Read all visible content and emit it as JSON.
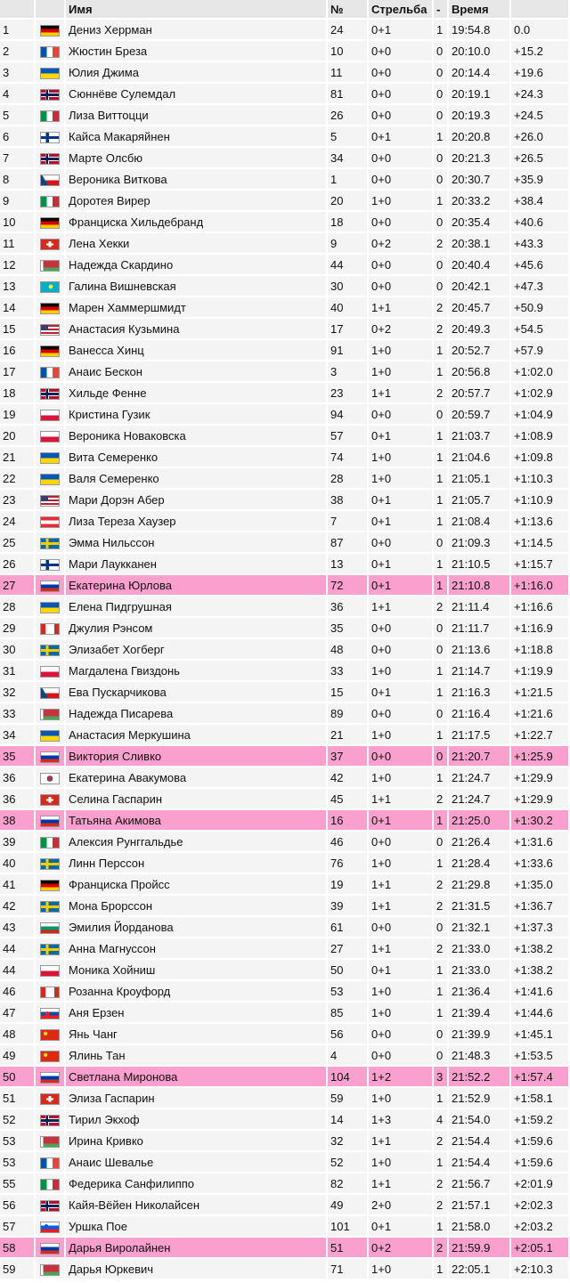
{
  "headers": {
    "pos": "",
    "flag": "",
    "name": "Имя",
    "no": "№",
    "shooting": "Стрельба",
    "penalty": "-",
    "time": "Время",
    "gap": ""
  },
  "colors": {
    "highlight": "#f9a0cf",
    "header": "#e7e7e7",
    "row": "#f4f4f4"
  },
  "rows": [
    {
      "pos": "1",
      "flag": "germany-flag",
      "name": "Дениз Херрман",
      "no": "24",
      "shooting": "0+1",
      "penalty": "1",
      "time": "19:54.8",
      "gap": "0.0",
      "hl": false
    },
    {
      "pos": "2",
      "flag": "france-flag",
      "name": "Жюстин Бреза",
      "no": "10",
      "shooting": "0+0",
      "penalty": "0",
      "time": "20:10.0",
      "gap": "+15.2",
      "hl": false
    },
    {
      "pos": "3",
      "flag": "ukraine-flag",
      "name": "Юлия Джима",
      "no": "11",
      "shooting": "0+0",
      "penalty": "0",
      "time": "20:14.4",
      "gap": "+19.6",
      "hl": false
    },
    {
      "pos": "4",
      "flag": "norway-flag",
      "name": "Сюннёве Сулемдал",
      "no": "81",
      "shooting": "0+0",
      "penalty": "0",
      "time": "20:19.1",
      "gap": "+24.3",
      "hl": false
    },
    {
      "pos": "5",
      "flag": "italy-flag",
      "name": "Лиза Виттоцци",
      "no": "26",
      "shooting": "0+0",
      "penalty": "0",
      "time": "20:19.3",
      "gap": "+24.5",
      "hl": false
    },
    {
      "pos": "6",
      "flag": "finland-flag",
      "name": "Кайса Макаряйнен",
      "no": "5",
      "shooting": "0+1",
      "penalty": "1",
      "time": "20:20.8",
      "gap": "+26.0",
      "hl": false
    },
    {
      "pos": "7",
      "flag": "norway-flag",
      "name": "Марте Олсбю",
      "no": "34",
      "shooting": "0+0",
      "penalty": "0",
      "time": "20:21.3",
      "gap": "+26.5",
      "hl": false
    },
    {
      "pos": "8",
      "flag": "czech-flag",
      "name": "Вероника Виткова",
      "no": "1",
      "shooting": "0+0",
      "penalty": "0",
      "time": "20:30.7",
      "gap": "+35.9",
      "hl": false
    },
    {
      "pos": "9",
      "flag": "italy-flag",
      "name": "Доротея Вирер",
      "no": "20",
      "shooting": "1+0",
      "penalty": "1",
      "time": "20:33.2",
      "gap": "+38.4",
      "hl": false
    },
    {
      "pos": "10",
      "flag": "germany-flag",
      "name": "Франциска Хильдебранд",
      "no": "18",
      "shooting": "0+0",
      "penalty": "0",
      "time": "20:35.4",
      "gap": "+40.6",
      "hl": false
    },
    {
      "pos": "11",
      "flag": "switzerland-flag",
      "name": "Лена Хекки",
      "no": "9",
      "shooting": "0+2",
      "penalty": "2",
      "time": "20:38.1",
      "gap": "+43.3",
      "hl": false
    },
    {
      "pos": "12",
      "flag": "belarus-flag",
      "name": "Надежда Скардино",
      "no": "44",
      "shooting": "0+0",
      "penalty": "0",
      "time": "20:40.4",
      "gap": "+45.6",
      "hl": false
    },
    {
      "pos": "13",
      "flag": "kazakhstan-flag",
      "name": "Галина Вишневская",
      "no": "30",
      "shooting": "0+0",
      "penalty": "0",
      "time": "20:42.1",
      "gap": "+47.3",
      "hl": false
    },
    {
      "pos": "14",
      "flag": "germany-flag",
      "name": "Марен Хаммершмидт",
      "no": "40",
      "shooting": "1+1",
      "penalty": "2",
      "time": "20:45.7",
      "gap": "+50.9",
      "hl": false
    },
    {
      "pos": "15",
      "flag": "usa-flag",
      "name": "Анастасия Кузьмина",
      "no": "17",
      "shooting": "0+2",
      "penalty": "2",
      "time": "20:49.3",
      "gap": "+54.5",
      "hl": false
    },
    {
      "pos": "16",
      "flag": "germany-flag",
      "name": "Ванесса Хинц",
      "no": "91",
      "shooting": "1+0",
      "penalty": "1",
      "time": "20:52.7",
      "gap": "+57.9",
      "hl": false
    },
    {
      "pos": "17",
      "flag": "france-flag",
      "name": "Анаис Бескон",
      "no": "3",
      "shooting": "1+0",
      "penalty": "1",
      "time": "20:56.8",
      "gap": "+1:02.0",
      "hl": false
    },
    {
      "pos": "18",
      "flag": "norway-flag",
      "name": "Хильде Фенне",
      "no": "23",
      "shooting": "1+1",
      "penalty": "2",
      "time": "20:57.7",
      "gap": "+1:02.9",
      "hl": false
    },
    {
      "pos": "19",
      "flag": "poland-flag",
      "name": "Кристина Гузик",
      "no": "94",
      "shooting": "0+0",
      "penalty": "0",
      "time": "20:59.7",
      "gap": "+1:04.9",
      "hl": false
    },
    {
      "pos": "20",
      "flag": "poland-flag",
      "name": "Вероника Новаковска",
      "no": "57",
      "shooting": "0+1",
      "penalty": "1",
      "time": "21:03.7",
      "gap": "+1:08.9",
      "hl": false
    },
    {
      "pos": "21",
      "flag": "ukraine-flag",
      "name": "Вита Семеренко",
      "no": "74",
      "shooting": "1+0",
      "penalty": "1",
      "time": "21:04.6",
      "gap": "+1:09.8",
      "hl": false
    },
    {
      "pos": "22",
      "flag": "ukraine-flag",
      "name": "Валя Семеренко",
      "no": "28",
      "shooting": "1+0",
      "penalty": "1",
      "time": "21:05.1",
      "gap": "+1:10.3",
      "hl": false
    },
    {
      "pos": "23",
      "flag": "usa-flag",
      "name": "Мари Дорэн Абер",
      "no": "38",
      "shooting": "0+1",
      "penalty": "1",
      "time": "21:05.7",
      "gap": "+1:10.9",
      "hl": false
    },
    {
      "pos": "24",
      "flag": "austria-flag",
      "name": "Лиза Тереза Хаузер",
      "no": "7",
      "shooting": "0+1",
      "penalty": "1",
      "time": "21:08.4",
      "gap": "+1:13.6",
      "hl": false
    },
    {
      "pos": "25",
      "flag": "sweden-flag",
      "name": "Эмма Нильссон",
      "no": "87",
      "shooting": "0+0",
      "penalty": "0",
      "time": "21:09.3",
      "gap": "+1:14.5",
      "hl": false
    },
    {
      "pos": "26",
      "flag": "finland-flag",
      "name": "Мари Лаукканен",
      "no": "13",
      "shooting": "0+1",
      "penalty": "1",
      "time": "21:10.5",
      "gap": "+1:15.7",
      "hl": false
    },
    {
      "pos": "27",
      "flag": "russia-flag",
      "name": "Екатерина Юрлова",
      "no": "72",
      "shooting": "0+1",
      "penalty": "1",
      "time": "21:10.8",
      "gap": "+1:16.0",
      "hl": true
    },
    {
      "pos": "28",
      "flag": "ukraine-flag",
      "name": "Елена Пидгрушная",
      "no": "36",
      "shooting": "1+1",
      "penalty": "2",
      "time": "21:11.4",
      "gap": "+1:16.6",
      "hl": false
    },
    {
      "pos": "29",
      "flag": "canada-flag",
      "name": "Джулия Рэнсом",
      "no": "35",
      "shooting": "0+0",
      "penalty": "0",
      "time": "21:11.7",
      "gap": "+1:16.9",
      "hl": false
    },
    {
      "pos": "30",
      "flag": "sweden-flag",
      "name": "Элизабет Хогберг",
      "no": "48",
      "shooting": "0+0",
      "penalty": "0",
      "time": "21:13.6",
      "gap": "+1:18.8",
      "hl": false
    },
    {
      "pos": "31",
      "flag": "poland-flag",
      "name": "Магдалена Гвиздонь",
      "no": "33",
      "shooting": "1+0",
      "penalty": "1",
      "time": "21:14.7",
      "gap": "+1:19.9",
      "hl": false
    },
    {
      "pos": "32",
      "flag": "czech-flag",
      "name": "Ева Пускарчикова",
      "no": "15",
      "shooting": "0+1",
      "penalty": "1",
      "time": "21:16.3",
      "gap": "+1:21.5",
      "hl": false
    },
    {
      "pos": "33",
      "flag": "belarus-flag",
      "name": "Надежда Писарева",
      "no": "89",
      "shooting": "0+0",
      "penalty": "0",
      "time": "21:16.4",
      "gap": "+1:21.6",
      "hl": false
    },
    {
      "pos": "34",
      "flag": "ukraine-flag",
      "name": "Анастасия Меркушина",
      "no": "21",
      "shooting": "1+0",
      "penalty": "1",
      "time": "21:17.5",
      "gap": "+1:22.7",
      "hl": false
    },
    {
      "pos": "35",
      "flag": "russia-flag",
      "name": "Виктория Сливко",
      "no": "37",
      "shooting": "0+0",
      "penalty": "0",
      "time": "21:20.7",
      "gap": "+1:25.9",
      "hl": true
    },
    {
      "pos": "36",
      "flag": "korea-flag",
      "name": "Екатерина Авакумова",
      "no": "42",
      "shooting": "1+0",
      "penalty": "1",
      "time": "21:24.7",
      "gap": "+1:29.9",
      "hl": false
    },
    {
      "pos": "36",
      "flag": "switzerland-flag",
      "name": "Селина Гаспарин",
      "no": "45",
      "shooting": "1+1",
      "penalty": "2",
      "time": "21:24.7",
      "gap": "+1:29.9",
      "hl": false
    },
    {
      "pos": "38",
      "flag": "russia-flag",
      "name": "Татьяна Акимова",
      "no": "16",
      "shooting": "0+1",
      "penalty": "1",
      "time": "21:25.0",
      "gap": "+1:30.2",
      "hl": true
    },
    {
      "pos": "39",
      "flag": "italy-flag",
      "name": "Алексия Рунггальдье",
      "no": "46",
      "shooting": "0+0",
      "penalty": "0",
      "time": "21:26.4",
      "gap": "+1:31.6",
      "hl": false
    },
    {
      "pos": "40",
      "flag": "sweden-flag",
      "name": "Линн Перссон",
      "no": "76",
      "shooting": "1+0",
      "penalty": "1",
      "time": "21:28.4",
      "gap": "+1:33.6",
      "hl": false
    },
    {
      "pos": "41",
      "flag": "germany-flag",
      "name": "Франциска Пройсс",
      "no": "19",
      "shooting": "1+1",
      "penalty": "2",
      "time": "21:29.8",
      "gap": "+1:35.0",
      "hl": false
    },
    {
      "pos": "42",
      "flag": "sweden-flag",
      "name": "Мона Брорссон",
      "no": "39",
      "shooting": "1+1",
      "penalty": "2",
      "time": "21:31.5",
      "gap": "+1:36.7",
      "hl": false
    },
    {
      "pos": "43",
      "flag": "bulgaria-flag",
      "name": "Эмилия Йорданова",
      "no": "61",
      "shooting": "0+0",
      "penalty": "0",
      "time": "21:32.1",
      "gap": "+1:37.3",
      "hl": false
    },
    {
      "pos": "44",
      "flag": "sweden-flag",
      "name": "Анна Магнуссон",
      "no": "27",
      "shooting": "1+1",
      "penalty": "2",
      "time": "21:33.0",
      "gap": "+1:38.2",
      "hl": false
    },
    {
      "pos": "44",
      "flag": "poland-flag",
      "name": "Моника Хойниш",
      "no": "50",
      "shooting": "0+1",
      "penalty": "1",
      "time": "21:33.0",
      "gap": "+1:38.2",
      "hl": false
    },
    {
      "pos": "46",
      "flag": "canada-flag",
      "name": "Розанна Кроуфорд",
      "no": "53",
      "shooting": "1+0",
      "penalty": "1",
      "time": "21:36.4",
      "gap": "+1:41.6",
      "hl": false
    },
    {
      "pos": "47",
      "flag": "slovakia-flag",
      "name": "Аня Ерзен",
      "no": "85",
      "shooting": "1+0",
      "penalty": "1",
      "time": "21:39.4",
      "gap": "+1:44.6",
      "hl": false
    },
    {
      "pos": "48",
      "flag": "china-flag",
      "name": "Янь Чанг",
      "no": "56",
      "shooting": "0+0",
      "penalty": "0",
      "time": "21:39.9",
      "gap": "+1:45.1",
      "hl": false
    },
    {
      "pos": "49",
      "flag": "china-flag",
      "name": "Ялинь Тан",
      "no": "4",
      "shooting": "0+0",
      "penalty": "0",
      "time": "21:48.3",
      "gap": "+1:53.5",
      "hl": false
    },
    {
      "pos": "50",
      "flag": "russia-flag",
      "name": "Светлана Миронова",
      "no": "104",
      "shooting": "1+2",
      "penalty": "3",
      "time": "21:52.2",
      "gap": "+1:57.4",
      "hl": true
    },
    {
      "pos": "51",
      "flag": "switzerland-flag",
      "name": "Элиза Гаспарин",
      "no": "59",
      "shooting": "1+0",
      "penalty": "1",
      "time": "21:52.9",
      "gap": "+1:58.1",
      "hl": false
    },
    {
      "pos": "52",
      "flag": "norway-flag",
      "name": "Тирил Экхоф",
      "no": "14",
      "shooting": "1+3",
      "penalty": "4",
      "time": "21:54.0",
      "gap": "+1:59.2",
      "hl": false
    },
    {
      "pos": "53",
      "flag": "belarus-flag",
      "name": "Ирина Кривко",
      "no": "32",
      "shooting": "1+1",
      "penalty": "2",
      "time": "21:54.4",
      "gap": "+1:59.6",
      "hl": false
    },
    {
      "pos": "53",
      "flag": "france-flag",
      "name": "Анаис Шевалье",
      "no": "52",
      "shooting": "1+0",
      "penalty": "1",
      "time": "21:54.4",
      "gap": "+1:59.6",
      "hl": false
    },
    {
      "pos": "55",
      "flag": "italy-flag",
      "name": "Федерика Санфилиппо",
      "no": "82",
      "shooting": "1+1",
      "penalty": "2",
      "time": "21:56.7",
      "gap": "+2:01.9",
      "hl": false
    },
    {
      "pos": "56",
      "flag": "norway-flag",
      "name": "Кайя-Вёйен Николайсен",
      "no": "49",
      "shooting": "2+0",
      "penalty": "2",
      "time": "21:57.1",
      "gap": "+2:02.3",
      "hl": false
    },
    {
      "pos": "57",
      "flag": "slovenia-flag",
      "name": "Уршка Пое",
      "no": "101",
      "shooting": "0+1",
      "penalty": "1",
      "time": "21:58.0",
      "gap": "+2:03.2",
      "hl": false
    },
    {
      "pos": "58",
      "flag": "russia-flag",
      "name": "Дарья Виролайнен",
      "no": "51",
      "shooting": "0+2",
      "penalty": "2",
      "time": "21:59.9",
      "gap": "+2:05.1",
      "hl": true
    },
    {
      "pos": "59",
      "flag": "belarus-flag",
      "name": "Дарья Юркевич",
      "no": "71",
      "shooting": "1+0",
      "penalty": "1",
      "time": "22:05.1",
      "gap": "+2:10.3",
      "hl": false
    }
  ]
}
